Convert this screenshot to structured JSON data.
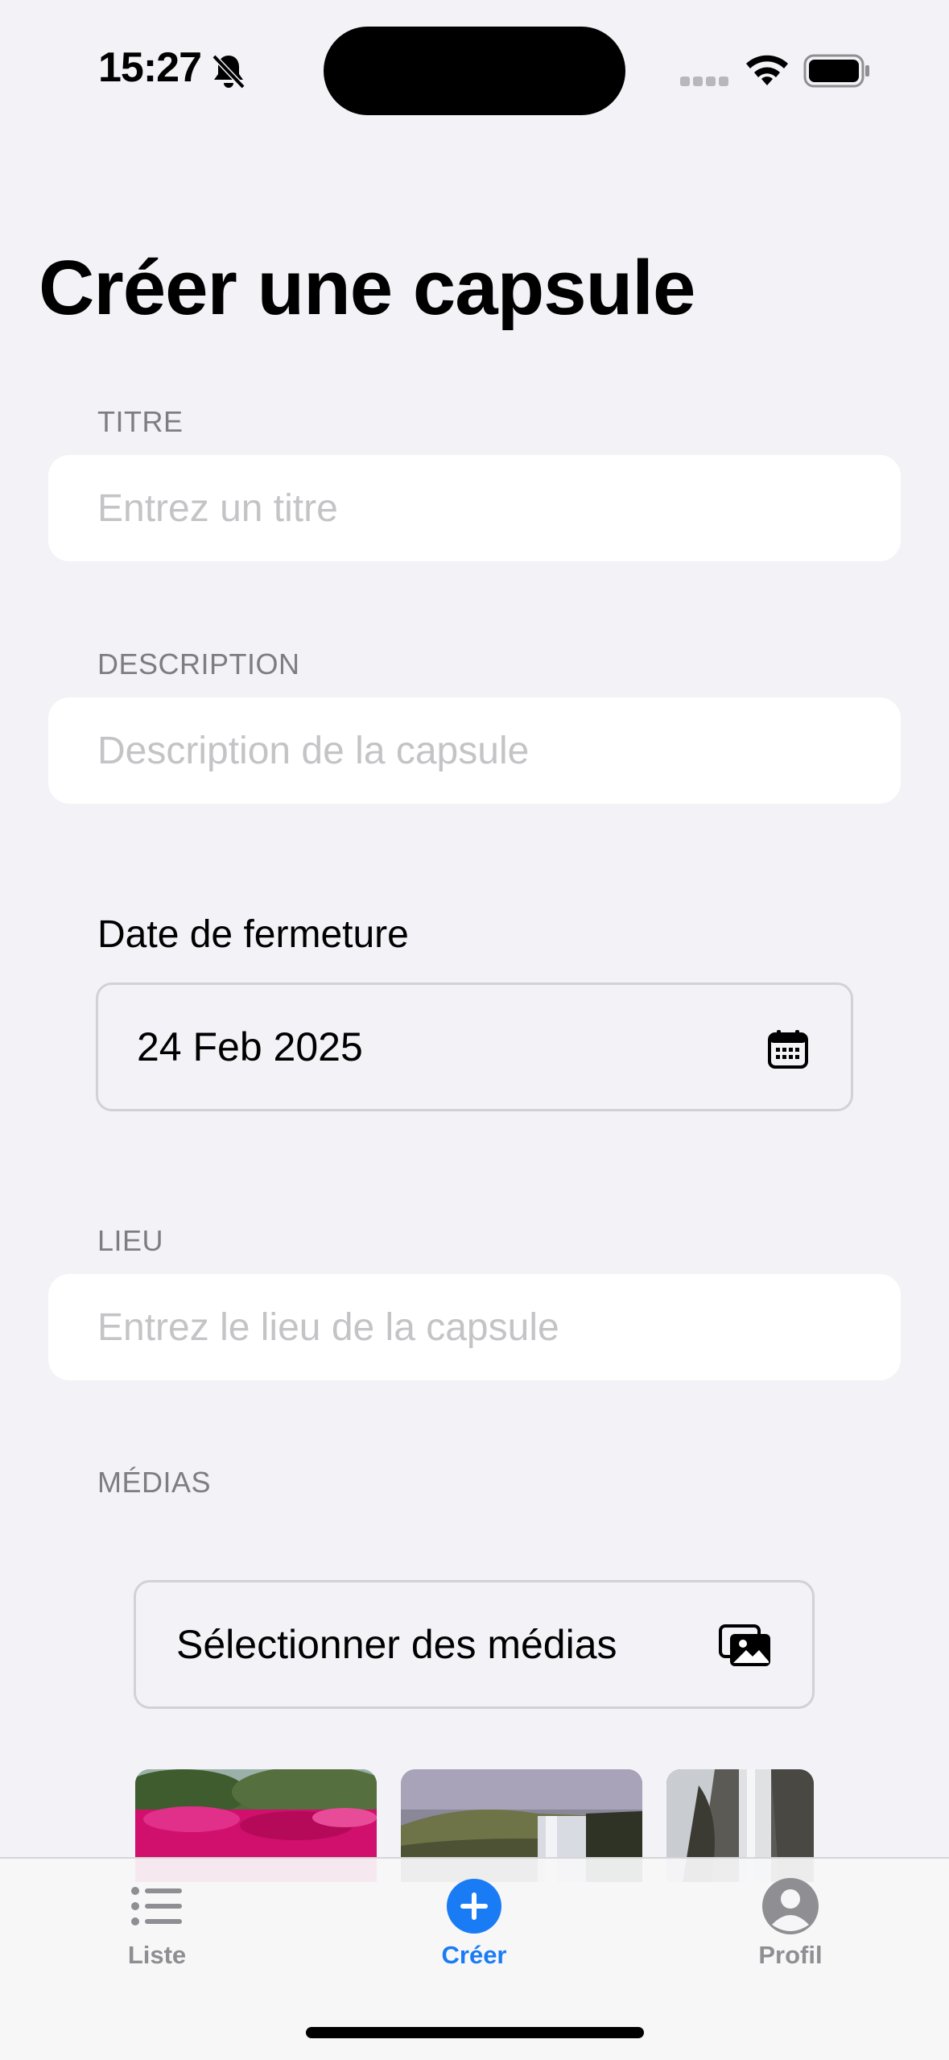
{
  "status_bar": {
    "time": "15:27",
    "icons": [
      "bell-slash-icon",
      "cellular-signal-icon",
      "wifi-icon",
      "battery-icon"
    ]
  },
  "page": {
    "title": "Créer une capsule"
  },
  "form": {
    "title_section": {
      "label": "TITRE",
      "placeholder": "Entrez un titre",
      "value": ""
    },
    "description_section": {
      "label": "DESCRIPTION",
      "placeholder": "Description de la capsule",
      "value": ""
    },
    "date_section": {
      "label": "Date de fermeture",
      "value": "24 Feb 2025",
      "icon": "calendar-icon"
    },
    "location_section": {
      "label": "LIEU",
      "placeholder": "Entrez le lieu de la capsule",
      "value": ""
    },
    "media_section": {
      "label": "MÉDIAS",
      "button_label": "Sélectionner des médias",
      "button_icon": "photos-icon",
      "thumbnails": [
        "pink-flowers-photo",
        "waterfall-cliff-photo",
        "waterfall-rocks-photo"
      ]
    }
  },
  "tab_bar": {
    "active_color": "#1a7cf5",
    "inactive_color": "#8e8e93",
    "tabs": [
      {
        "label": "Liste",
        "icon": "list-icon",
        "active": false
      },
      {
        "label": "Créer",
        "icon": "plus-circle-icon",
        "active": true
      },
      {
        "label": "Profil",
        "icon": "person-circle-icon",
        "active": false
      }
    ]
  }
}
